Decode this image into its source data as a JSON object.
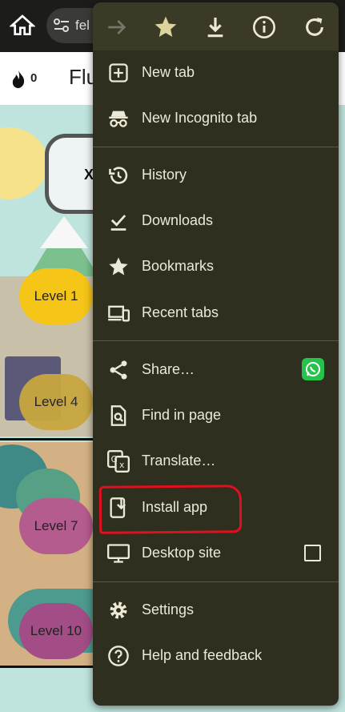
{
  "browser": {
    "url_text": "fel"
  },
  "app": {
    "streak_count": "0",
    "title": "Flu",
    "speech_text": "X",
    "levels": [
      "Level 1",
      "Level 4",
      "Level 7",
      "Level 10"
    ]
  },
  "menu": {
    "toolbar": {
      "icons": [
        "forward-icon",
        "star-filled-icon",
        "download-icon",
        "info-icon",
        "refresh-icon"
      ]
    },
    "items": [
      {
        "label": "New tab",
        "icon": "plus-box-icon"
      },
      {
        "label": "New Incognito tab",
        "icon": "incognito-icon"
      },
      {
        "label": "History",
        "icon": "history-icon"
      },
      {
        "label": "Downloads",
        "icon": "download-check-icon"
      },
      {
        "label": "Bookmarks",
        "icon": "star-icon"
      },
      {
        "label": "Recent tabs",
        "icon": "devices-icon"
      },
      {
        "label": "Share…",
        "icon": "share-icon"
      },
      {
        "label": "Find in page",
        "icon": "find-in-page-icon"
      },
      {
        "label": "Translate…",
        "icon": "translate-icon"
      },
      {
        "label": "Install app",
        "icon": "install-app-icon"
      },
      {
        "label": "Desktop site",
        "icon": "monitor-icon"
      },
      {
        "label": "Settings",
        "icon": "gear-icon"
      },
      {
        "label": "Help and feedback",
        "icon": "help-icon"
      }
    ]
  },
  "colors": {
    "menu_bg": "#2f2f20",
    "menu_text": "#ece9d6",
    "highlight": "#e0101e",
    "whatsapp": "#27c24c"
  }
}
